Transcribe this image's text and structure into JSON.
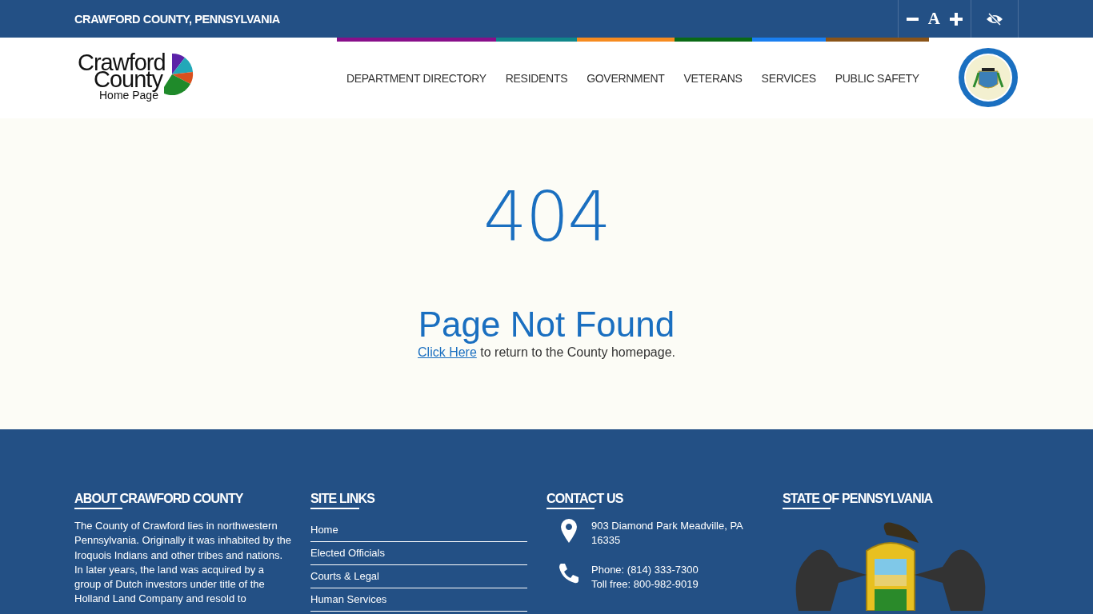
{
  "top_bar": {
    "title": "CRAWFORD COUNTY, PENNSYLVANIA",
    "text_size_label": "A"
  },
  "header": {
    "logo": {
      "line_1": "Crawford",
      "line_2": "County",
      "subtitle": "Home Page"
    },
    "nav": [
      {
        "label": "DEPARTMENT DIRECTORY",
        "color": "#880f8a"
      },
      {
        "label": "RESIDENTS",
        "color": "#10878a"
      },
      {
        "label": "GOVERNMENT",
        "color": "#f68b1f"
      },
      {
        "label": "VETERANS",
        "color": "#0a6a16"
      },
      {
        "label": "SERVICES",
        "color": "#1a7ff0"
      },
      {
        "label": "PUBLIC SAFETY",
        "color": "#8a5418"
      }
    ]
  },
  "main": {
    "code": "404",
    "title": "Page Not Found",
    "link": "Click Here",
    "message": " to return to the County homepage."
  },
  "footer": {
    "about": {
      "heading": "ABOUT CRAWFORD COUNTY",
      "text": "The County of Crawford lies in northwestern Pennsylvania. Originally it was inhabited by the Iroquois Indians and other tribes and nations. In later years, the land was acquired by a group of Dutch investors under title of the Holland Land Company and resold to"
    },
    "site_links": {
      "heading": "SITE LINKS",
      "links": [
        "Home",
        "Elected Officials",
        "Courts & Legal",
        "Human Services"
      ]
    },
    "contact": {
      "heading": "CONTACT US",
      "items": [
        {
          "kind": "address",
          "lines": [
            "903 Diamond Park Meadville, PA",
            "16335"
          ]
        },
        {
          "kind": "phone",
          "lines": [
            "Phone: (814) 333-7300",
            "Toll free: 800-982-9019"
          ]
        }
      ]
    },
    "state": {
      "heading": "STATE OF PENNSYLVANIA"
    }
  }
}
